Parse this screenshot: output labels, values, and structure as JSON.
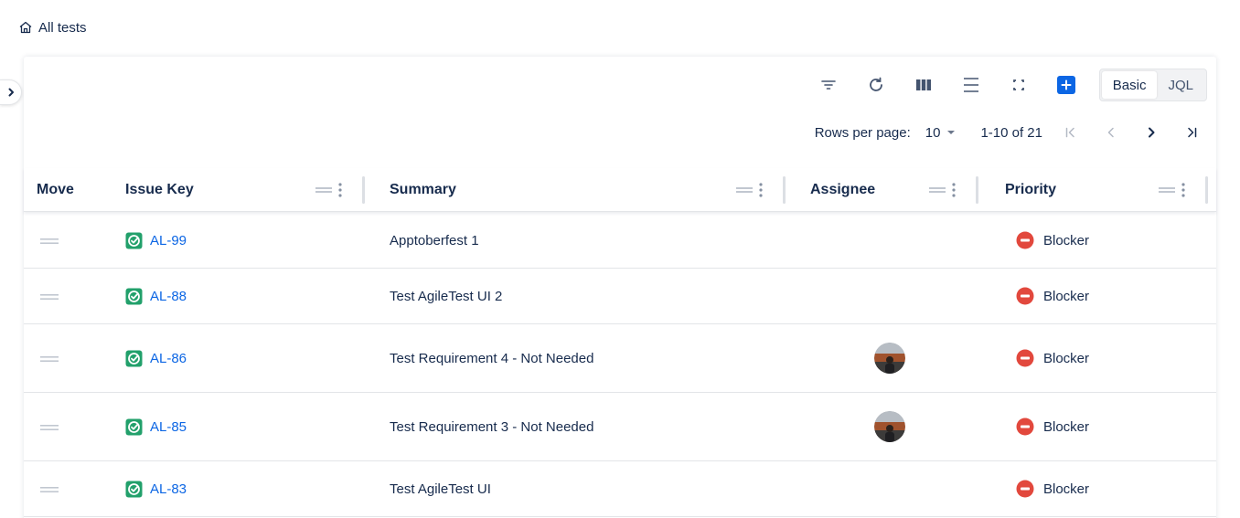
{
  "breadcrumb": {
    "label": "All tests",
    "icon": "home-icon"
  },
  "toolbar": {
    "icons": [
      "filter-icon",
      "refresh-icon",
      "columns-icon",
      "density-icon",
      "fullscreen-icon",
      "add-icon"
    ],
    "mode_basic": "Basic",
    "mode_jql": "JQL",
    "active_mode": "Basic",
    "accent": "#0c66e4"
  },
  "pagination": {
    "rows_per_page_label": "Rows per page:",
    "rows_per_page_value": "10",
    "range_text": "1-10 of 21"
  },
  "table": {
    "columns": [
      "Move",
      "Issue Key",
      "Summary",
      "Assignee",
      "Priority"
    ],
    "rows": [
      {
        "key": "AL-99",
        "summary": "Apptoberfest 1",
        "assignee": false,
        "priority": "Blocker"
      },
      {
        "key": "AL-88",
        "summary": "Test AgileTest UI 2",
        "assignee": false,
        "priority": "Blocker"
      },
      {
        "key": "AL-86",
        "summary": "Test Requirement 4 - Not Needed",
        "assignee": true,
        "priority": "Blocker"
      },
      {
        "key": "AL-85",
        "summary": "Test Requirement 3 - Not Needed",
        "assignee": true,
        "priority": "Blocker"
      },
      {
        "key": "AL-83",
        "summary": "Test AgileTest UI",
        "assignee": false,
        "priority": "Blocker"
      }
    ]
  },
  "colors": {
    "link": "#0c66e4",
    "test_icon": "#22a06b",
    "blocker": "#e2483d"
  }
}
